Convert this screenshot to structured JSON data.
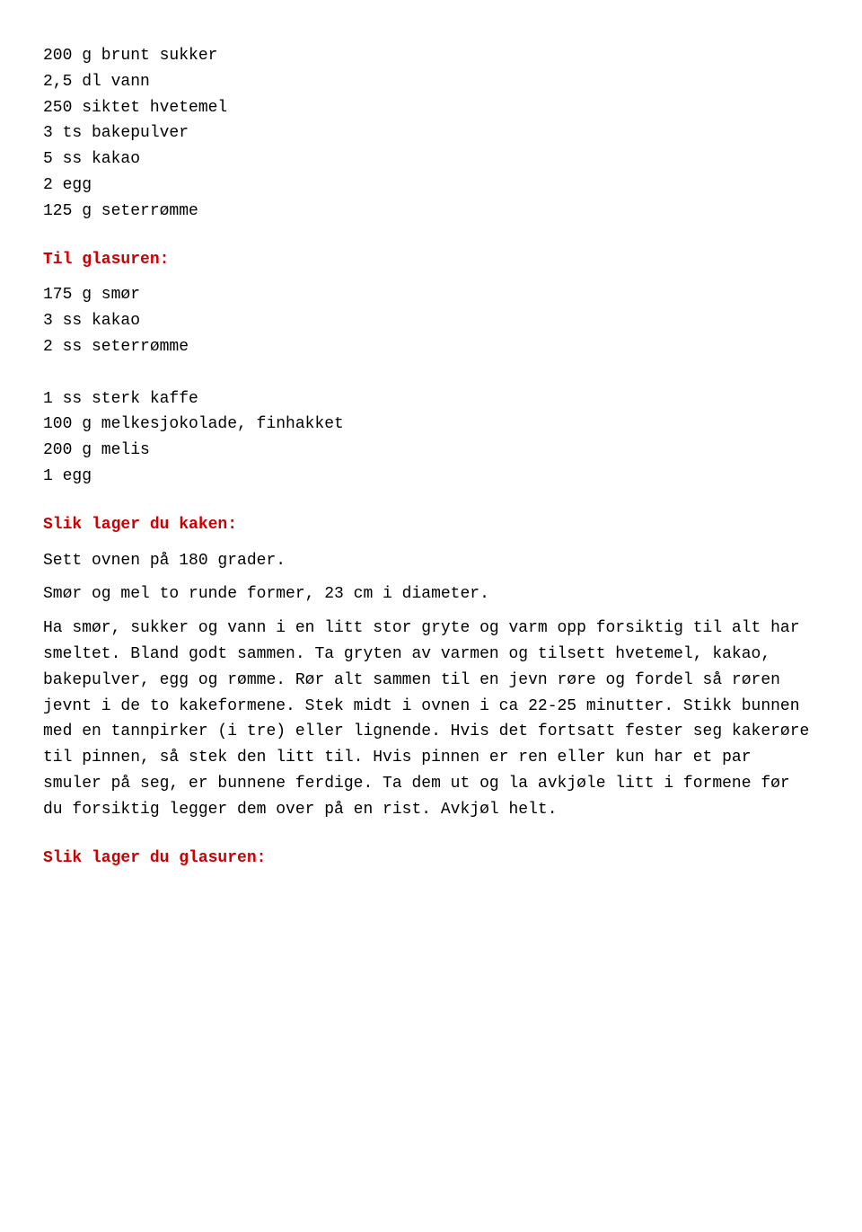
{
  "recipe": {
    "ingredients_main": [
      "200 g brunt sukker",
      "2,5 dl vann",
      "250 siktet hvetemel",
      "3 ts bakepulver",
      "5 ss kakao",
      "2 egg",
      "125 g seterrømme"
    ],
    "heading_glasuren": "Til glasuren:",
    "ingredients_glasuren": [
      "175 g smør",
      "3 ss kakao",
      "2 ss seterrømme",
      "",
      "1 ss sterk kaffe",
      "100 g melkesjokolade, finhakket",
      "200 g melis",
      "1 egg"
    ],
    "heading_lager_kaken": "Slik lager du kaken:",
    "instructions_kaken": [
      "Sett ovnen på 180 grader.",
      "Smør og mel to runde former, 23 cm i diameter.",
      "Ha smør, sukker og vann i en litt stor gryte og varm opp forsiktig til alt har smeltet. Bland godt sammen. Ta gryten av varmen og tilsett hvetemel, kakao, bakepulver, egg og rømme. Rør alt sammen til en jevn røre og fordel så røren jevnt i de to kakeformene. Stek midt i ovnen i ca 22-25 minutter. Stikk bunnen med en tannpirker (i tre) eller lignende. Hvis det fortsatt fester seg kakerøre til pinnen, så stek den litt til. Hvis pinnen er ren eller kun har et par smuler på seg, er bunnene ferdige. Ta dem ut og la avkjøle litt i formene før du forsiktig legger dem over på en rist. Avkjøl helt."
    ],
    "heading_lager_glasuren": "Slik lager du glasuren:"
  }
}
